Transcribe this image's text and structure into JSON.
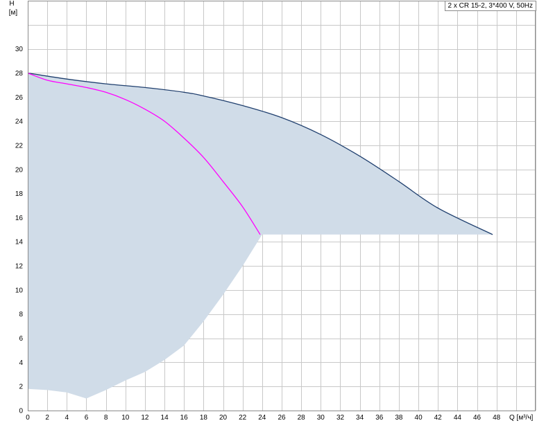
{
  "chart_data": {
    "type": "line",
    "title": "2 x CR 15-2, 3*400 V, 50Hz",
    "xlabel": "Q [м³/ч]",
    "ylabel": "H",
    "ylabel_unit": "[м]",
    "xlim": [
      0,
      52
    ],
    "ylim": [
      0,
      34
    ],
    "x_ticks": [
      0,
      2,
      4,
      6,
      8,
      10,
      12,
      14,
      16,
      18,
      20,
      22,
      24,
      26,
      28,
      30,
      32,
      34,
      36,
      38,
      40,
      42,
      44,
      46,
      48
    ],
    "y_ticks": [
      0,
      2,
      4,
      6,
      8,
      10,
      12,
      14,
      16,
      18,
      20,
      22,
      24,
      26,
      28,
      30
    ],
    "grid": true,
    "colors": {
      "area": "#d0dce8",
      "series_1": "#1f3f6e",
      "series_2": "#ff00ff",
      "grid": "#c8c8c8"
    },
    "area": {
      "points": [
        [
          0,
          28.0
        ],
        [
          6,
          27.3
        ],
        [
          12,
          26.8
        ],
        [
          18,
          26.1
        ],
        [
          22,
          25.3
        ],
        [
          26,
          24.3
        ],
        [
          30,
          22.9
        ],
        [
          34,
          21.1
        ],
        [
          38,
          19.0
        ],
        [
          42,
          16.8
        ],
        [
          47.6,
          14.6
        ],
        [
          24,
          14.6
        ],
        [
          22,
          12.0
        ],
        [
          20,
          9.6
        ],
        [
          18,
          7.4
        ],
        [
          16,
          5.4
        ],
        [
          14,
          4.2
        ],
        [
          12,
          3.2
        ],
        [
          10,
          2.5
        ],
        [
          8,
          1.7
        ],
        [
          6,
          1.0
        ],
        [
          4,
          1.5
        ],
        [
          2,
          1.7
        ],
        [
          0,
          1.8
        ]
      ]
    },
    "series": [
      {
        "color": "#1f3f6e",
        "points": [
          [
            0,
            28.0
          ],
          [
            4,
            27.5
          ],
          [
            8,
            27.1
          ],
          [
            12,
            26.8
          ],
          [
            16,
            26.4
          ],
          [
            18,
            26.1
          ],
          [
            22,
            25.3
          ],
          [
            26,
            24.3
          ],
          [
            30,
            22.9
          ],
          [
            34,
            21.1
          ],
          [
            38,
            19.0
          ],
          [
            42,
            16.8
          ],
          [
            47.6,
            14.6
          ]
        ]
      },
      {
        "color": "#ff00ff",
        "points": [
          [
            0,
            28.0
          ],
          [
            2,
            27.4
          ],
          [
            4,
            27.1
          ],
          [
            6,
            26.8
          ],
          [
            8,
            26.4
          ],
          [
            10,
            25.8
          ],
          [
            12,
            25.0
          ],
          [
            14,
            24.0
          ],
          [
            16,
            22.6
          ],
          [
            18,
            21.0
          ],
          [
            20,
            19.0
          ],
          [
            22,
            16.9
          ],
          [
            23.8,
            14.6
          ]
        ]
      }
    ]
  }
}
